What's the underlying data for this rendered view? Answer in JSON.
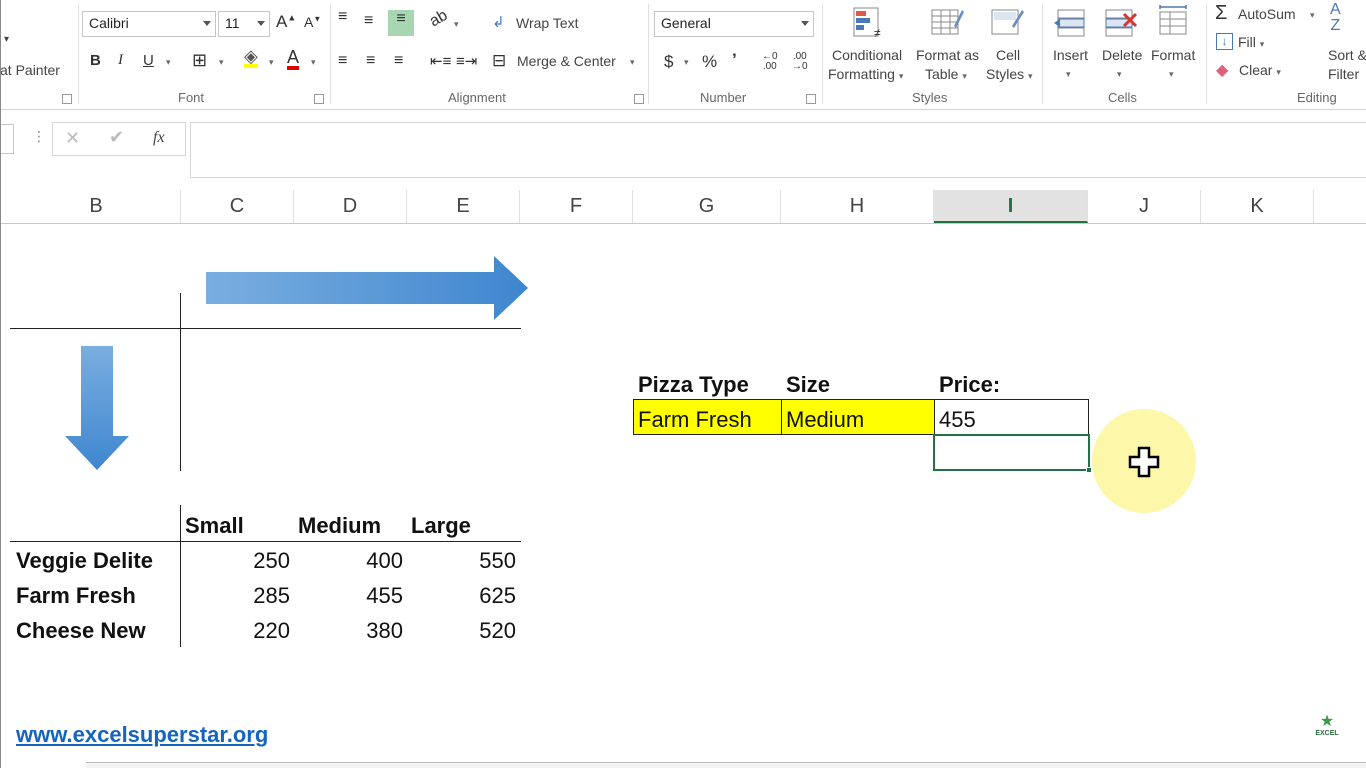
{
  "ribbon": {
    "clipboard": {
      "format_painter": "at Painter"
    },
    "font": {
      "label": "Font",
      "name": "Calibri",
      "size": "11",
      "bold": "B",
      "italic": "I",
      "underline": "U"
    },
    "alignment": {
      "label": "Alignment",
      "wrap_text": "Wrap Text",
      "merge_center": "Merge & Center"
    },
    "number": {
      "label": "Number",
      "format": "General",
      "currency": "$",
      "percent": "%",
      "comma": "’",
      "inc_decimal": "←.0\n.00",
      "dec_decimal": ".00\n→.0"
    },
    "styles": {
      "label": "Styles",
      "conditional_formatting": [
        "Conditional",
        "Formatting"
      ],
      "format_as_table": [
        "Format as",
        "Table"
      ],
      "cell_styles": [
        "Cell",
        "Styles"
      ]
    },
    "cells": {
      "label": "Cells",
      "insert": "Insert",
      "delete": "Delete",
      "format": "Format"
    },
    "editing": {
      "label": "Editing",
      "autosum": "AutoSum",
      "fill": "Fill",
      "clear": "Clear",
      "sort_filter": [
        "Sort &",
        "Filter"
      ]
    }
  },
  "formula_bar": {
    "fx": "fx",
    "value": ""
  },
  "columns": [
    "B",
    "C",
    "D",
    "E",
    "F",
    "G",
    "H",
    "I",
    "J",
    "K"
  ],
  "active_column": "I",
  "lookup": {
    "headers": [
      "Pizza Type",
      "Size",
      "Price:"
    ],
    "values": [
      "Farm Fresh",
      "Medium",
      "455"
    ]
  },
  "price_table": {
    "sizes": [
      "Small",
      "Medium",
      "Large"
    ],
    "rows": [
      {
        "type": "Veggie Delite",
        "prices": [
          "250",
          "400",
          "550"
        ]
      },
      {
        "type": "Farm Fresh",
        "prices": [
          "285",
          "455",
          "625"
        ]
      },
      {
        "type": "Cheese New",
        "prices": [
          "220",
          "380",
          "520"
        ]
      }
    ]
  },
  "footer": {
    "website": "www.excelsuperstar.org",
    "logo_text": "EXCEL"
  },
  "colors": {
    "highlight": "#ffff00",
    "selection": "#217346",
    "arrow": "#4a8fd4",
    "cursor_halo": "#fdf7a0"
  }
}
